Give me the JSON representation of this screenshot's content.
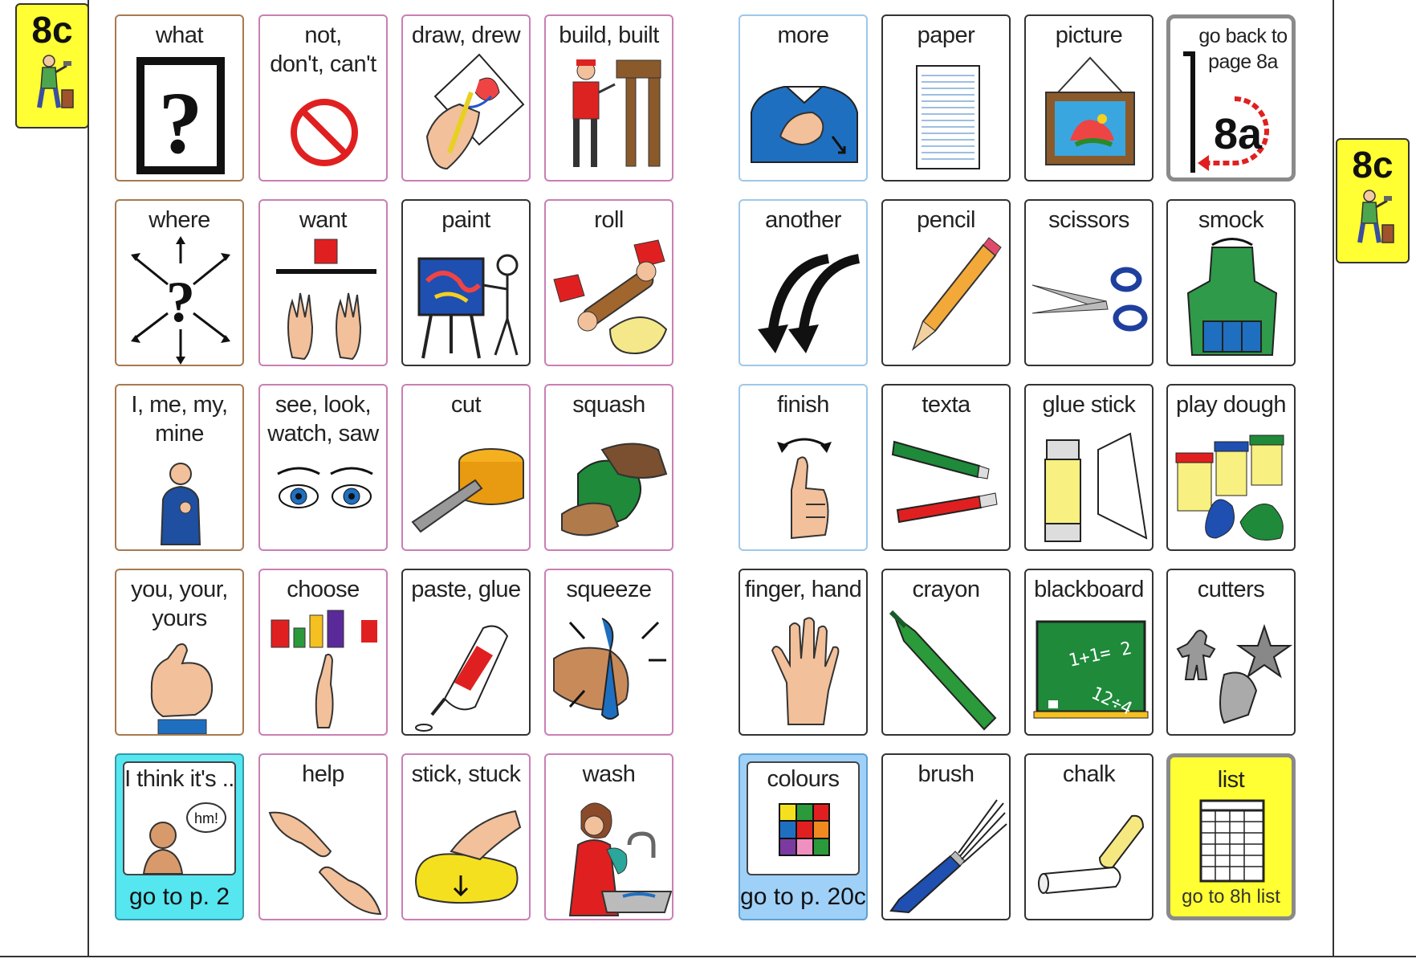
{
  "page": {
    "tab_left": "8c",
    "tab_right": "8c"
  },
  "cells": [
    {
      "id": "what",
      "label": "what"
    },
    {
      "id": "not",
      "label": "not,\ndon't, can't"
    },
    {
      "id": "draw",
      "label": "draw, drew"
    },
    {
      "id": "build",
      "label": "build, built"
    },
    {
      "id": "more",
      "label": "more"
    },
    {
      "id": "paper",
      "label": "paper"
    },
    {
      "id": "picture",
      "label": "picture"
    },
    {
      "id": "goback",
      "label": "go back to\npage 8a",
      "badge": "8a"
    },
    {
      "id": "where",
      "label": "where"
    },
    {
      "id": "want",
      "label": "want"
    },
    {
      "id": "paint",
      "label": "paint"
    },
    {
      "id": "roll",
      "label": "roll"
    },
    {
      "id": "another",
      "label": "another"
    },
    {
      "id": "pencil",
      "label": "pencil"
    },
    {
      "id": "scissors",
      "label": "scissors"
    },
    {
      "id": "smock",
      "label": "smock"
    },
    {
      "id": "me",
      "label": "I,  me, my,\nmine"
    },
    {
      "id": "see",
      "label": "see, look,\nwatch, saw"
    },
    {
      "id": "cut",
      "label": "cut"
    },
    {
      "id": "squash",
      "label": "squash"
    },
    {
      "id": "finish",
      "label": "finish"
    },
    {
      "id": "texta",
      "label": "texta"
    },
    {
      "id": "gluestick",
      "label": "glue stick"
    },
    {
      "id": "playdough",
      "label": "play dough"
    },
    {
      "id": "you",
      "label": "you, your,\nyours"
    },
    {
      "id": "choose",
      "label": "choose"
    },
    {
      "id": "paste",
      "label": "paste,  glue"
    },
    {
      "id": "squeeze",
      "label": "squeeze"
    },
    {
      "id": "finger",
      "label": "finger, hand"
    },
    {
      "id": "crayon",
      "label": "crayon"
    },
    {
      "id": "blackboard",
      "label": "blackboard",
      "board_text_1": "1+1= 2",
      "board_text_2": "12÷4"
    },
    {
      "id": "cutters",
      "label": "cutters"
    },
    {
      "id": "thinkits",
      "label": "I think it's ..",
      "goto": "go to p. 2",
      "bubble": "hm!"
    },
    {
      "id": "help",
      "label": "help"
    },
    {
      "id": "stick",
      "label": "stick, stuck"
    },
    {
      "id": "wash",
      "label": "wash"
    },
    {
      "id": "colours",
      "label": "colours",
      "goto": "go to p. 20c"
    },
    {
      "id": "brush",
      "label": "brush"
    },
    {
      "id": "chalk",
      "label": "chalk"
    },
    {
      "id": "list",
      "label": "list",
      "goto": "go to 8h list"
    }
  ]
}
